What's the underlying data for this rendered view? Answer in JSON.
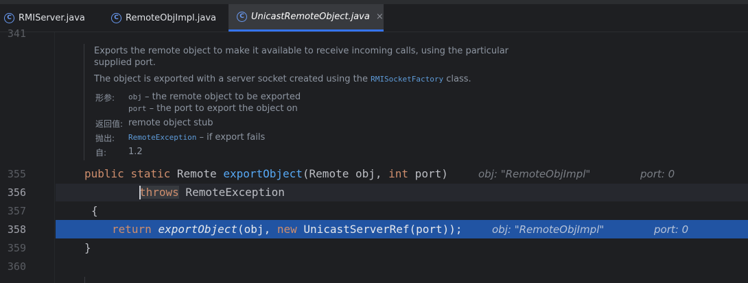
{
  "tabs": [
    {
      "icon": "C",
      "label": "RMIServer.java"
    },
    {
      "icon": "C",
      "label": "RemoteObjImpl.java"
    },
    {
      "icon": "C",
      "label": "UnicastRemoteObject.java",
      "close": "×"
    }
  ],
  "gutter": {
    "partial_line": "341",
    "lines": [
      "355",
      "356",
      "357",
      "358",
      "359",
      "360"
    ]
  },
  "doc": {
    "line1": "Exports the remote object to make it available to receive incoming calls, using the particular",
    "line2": "supplied port.",
    "exported_prefix": "The object is exported with a server socket created using the ",
    "exported_link": "RMISocketFactory",
    "exported_suffix": " class.",
    "params_tag": "形参:",
    "param1_name": "obj",
    "param1_desc": " – the remote object to be exported",
    "param2_name": "port",
    "param2_desc": " – the port to export the object on",
    "returns_tag": "返回值:",
    "returns_desc": "remote object stub",
    "throws_tag": "抛出:",
    "throws_link": "RemoteException",
    "throws_desc": " – if export fails",
    "since_tag": "自:",
    "since_desc": "1.2"
  },
  "code": {
    "l355_public": "public",
    "l355_static": "static",
    "l355_type": "Remote",
    "l355_fn": "exportObject",
    "l355_params_a": "(Remote obj, ",
    "l355_int": "int",
    "l355_params_b": " port)",
    "l355_hint_obj": "obj: \"RemoteObjImpl\"",
    "l355_hint_port": "port: 0",
    "l356_throws": "throws",
    "l356_exc": " RemoteException",
    "l357": "{",
    "l358_return": "return",
    "l358_fn": "exportObject",
    "l358_a": "(obj, ",
    "l358_new": "new",
    "l358_b": " UnicastServerRef(port));",
    "l358_hint_obj": "obj: \"RemoteObjImpl\"",
    "l358_hint_port": "port: 0",
    "l359": "}"
  }
}
